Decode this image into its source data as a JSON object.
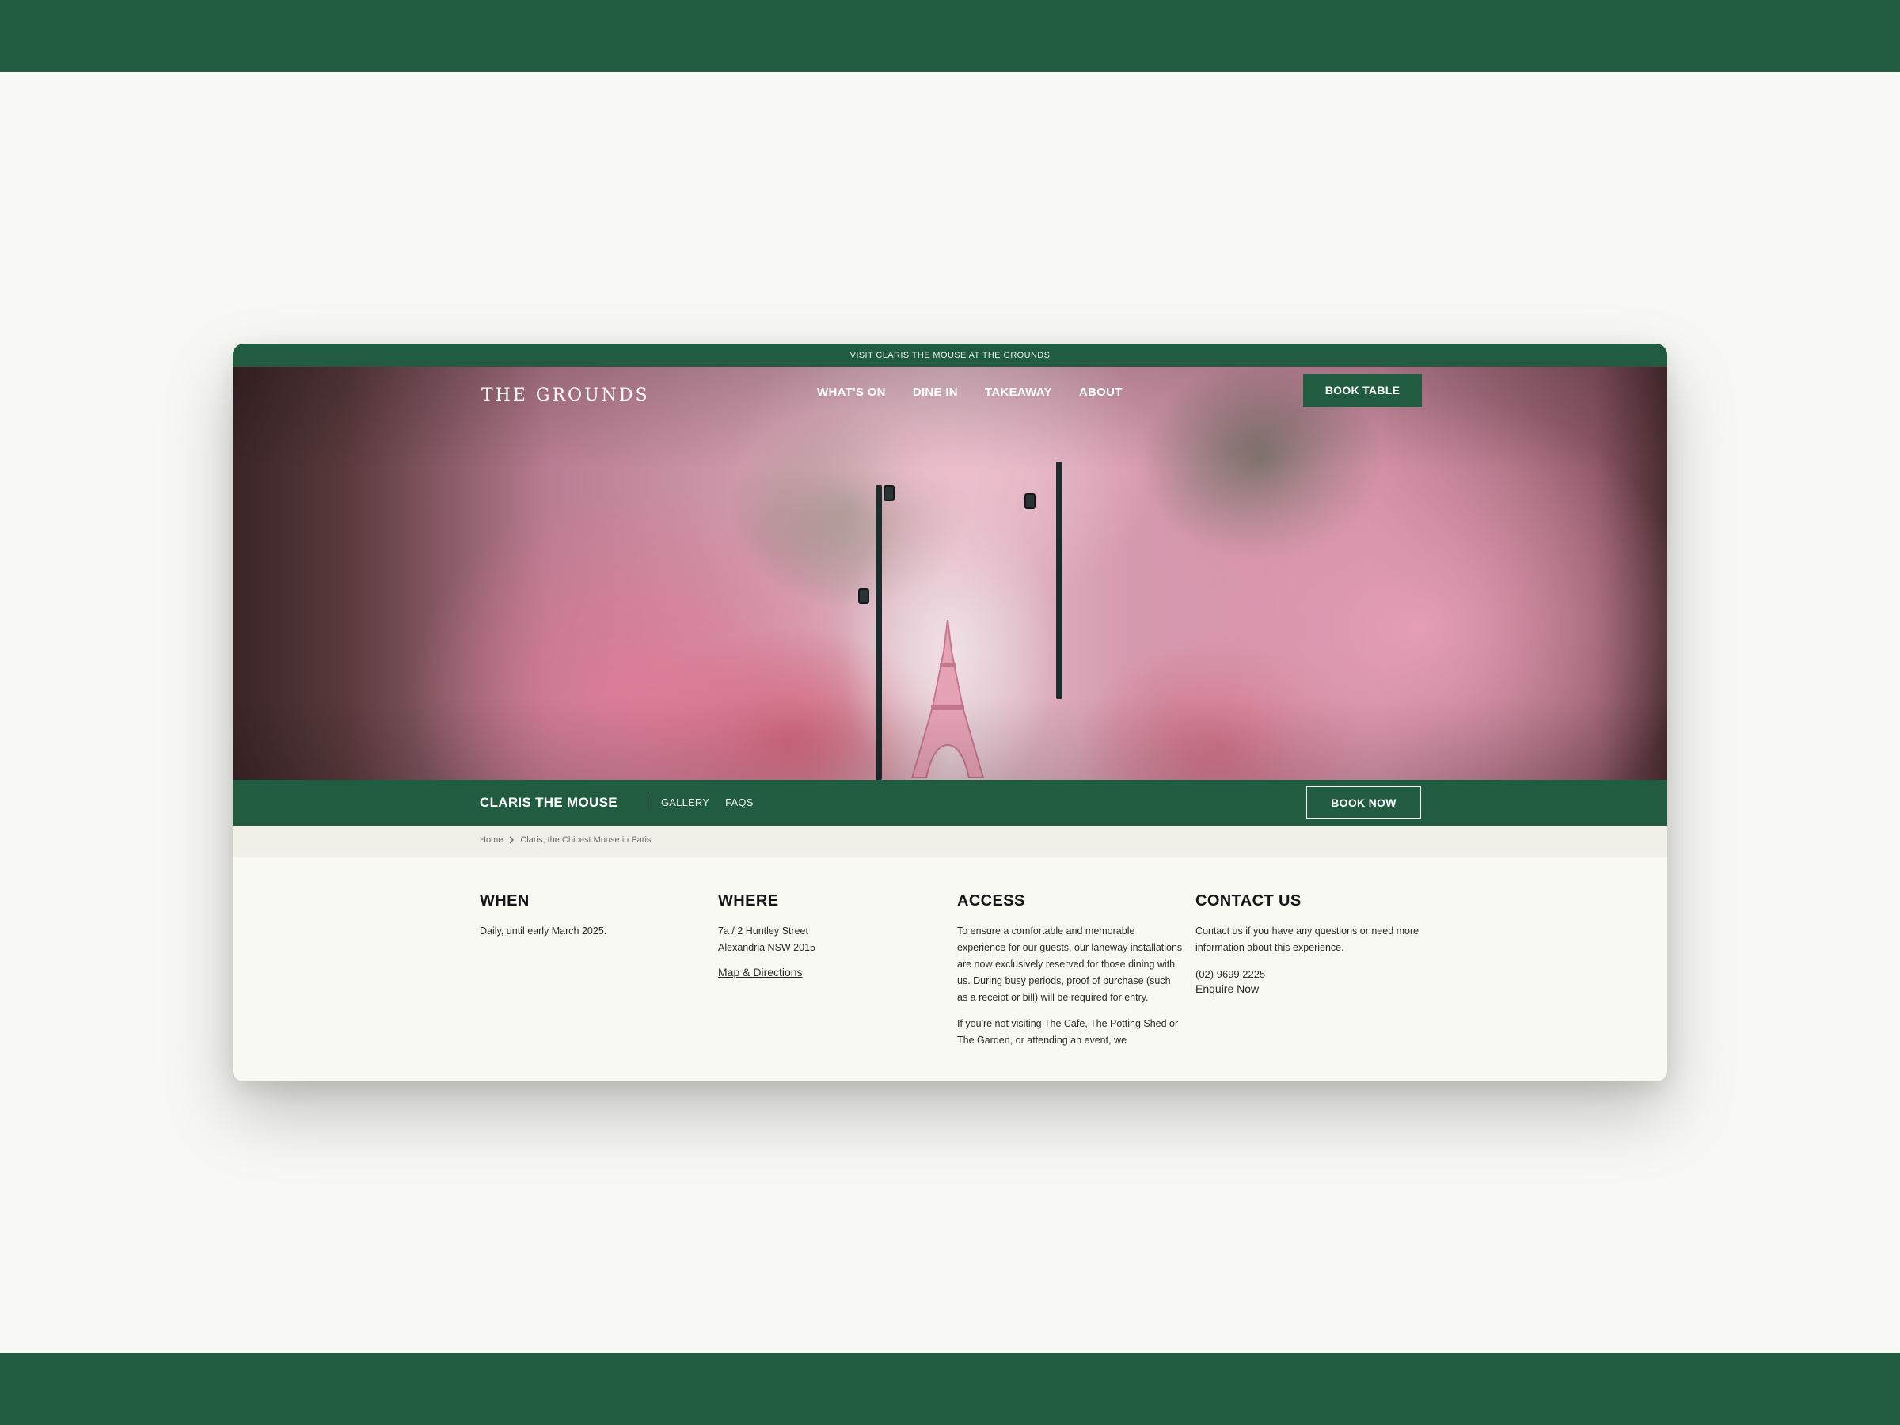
{
  "announcement": "VISIT CLARIS THE MOUSE AT THE GROUNDS",
  "header": {
    "logo": "THE GROUNDS",
    "nav": [
      "WHAT'S ON",
      "DINE IN",
      "TAKEAWAY",
      "ABOUT"
    ],
    "book_table": "BOOK TABLE"
  },
  "subnav": {
    "title": "CLARIS THE MOUSE",
    "links": [
      "GALLERY",
      "FAQS"
    ],
    "book_now": "BOOK NOW"
  },
  "breadcrumb": {
    "home": "Home",
    "current": "Claris, the Chicest Mouse in Paris"
  },
  "info": {
    "when": {
      "heading": "WHEN",
      "text": "Daily, until early March 2025."
    },
    "where": {
      "heading": "WHERE",
      "address_line1": "7a / 2 Huntley Street",
      "address_line2": "Alexandria NSW 2015",
      "link": "Map & Directions"
    },
    "access": {
      "heading": "ACCESS",
      "para1": "To ensure a comfortable and memorable experience for our guests, our laneway installations are now exclusively reserved for those dining with us. During busy periods, proof of purchase (such as a receipt or bill) will be required for entry.",
      "para2": "If you're not visiting The Cafe, The Potting Shed or The Garden, or attending an event, we"
    },
    "contact": {
      "heading": "CONTACT US",
      "text": "Contact us if you have any questions or need more information about this experience.",
      "phone": "(02) 9699 2225",
      "link": "Enquire Now"
    }
  },
  "colors": {
    "brand_green": "#215c41",
    "page_background": "#f8f8f4",
    "breadcrumb_background": "#f1f0e8"
  },
  "hero_image": "pink blossom laneway with miniature Eiffel Tower"
}
